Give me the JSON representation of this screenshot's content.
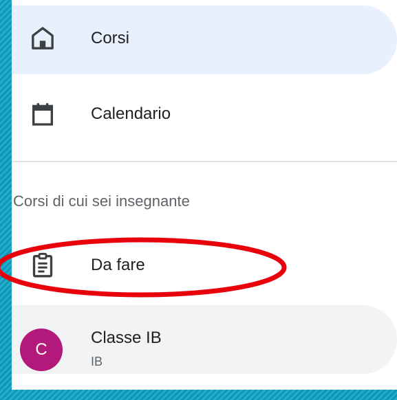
{
  "nav": {
    "courses": {
      "label": "Corsi",
      "icon": "home-icon"
    },
    "calendar": {
      "label": "Calendario",
      "icon": "calendar-icon"
    }
  },
  "section": {
    "title": "Corsi di cui sei insegnante"
  },
  "todo": {
    "label": "Da fare",
    "icon": "assignment-icon"
  },
  "class_item": {
    "avatar_letter": "C",
    "title": "Classe IB",
    "subtitle": "IB",
    "avatar_color": "#b3197a"
  },
  "colors": {
    "active_bg": "#e8f0fe",
    "annotation": "#e8000b",
    "frame": "#1aa6c6"
  }
}
